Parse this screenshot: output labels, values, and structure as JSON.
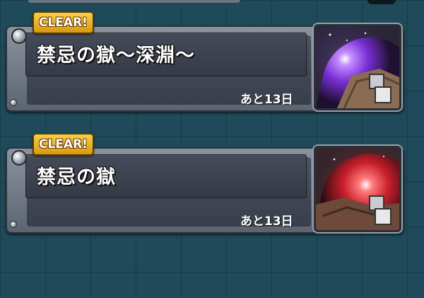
{
  "quests": [
    {
      "badge": "CLEAR!",
      "title": "禁忌の獄～深淵～",
      "remaining": "あと13日",
      "thumbnail_icon": "dungeon-purple-portal-icon",
      "thumbnail_glow": "#8b3df0"
    },
    {
      "badge": "CLEAR!",
      "title": "禁忌の獄",
      "remaining": "あと13日",
      "thumbnail_icon": "dungeon-red-portal-icon",
      "thumbnail_glow": "#e83232"
    }
  ],
  "colors": {
    "background": "#1f4a5a",
    "badge": "#f2c230",
    "frame": "#7a838e"
  }
}
